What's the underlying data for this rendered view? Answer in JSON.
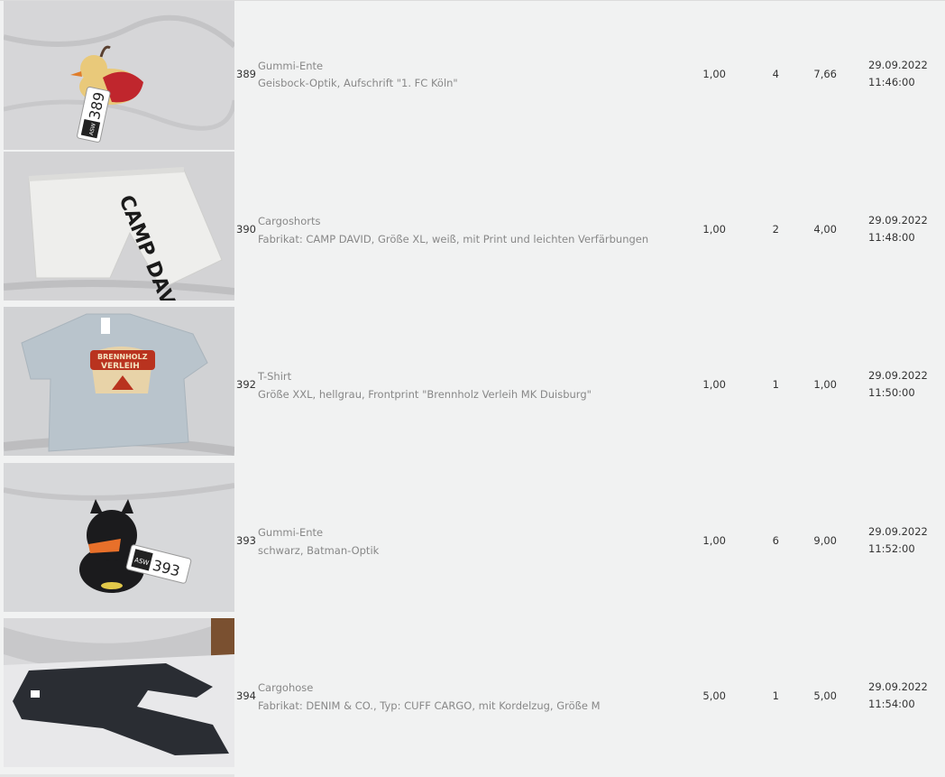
{
  "items": [
    {
      "lot": "389",
      "title": "Gummi-Ente",
      "desc": "Geisbock-Optik, Aufschrift \"1. FC Köln\"",
      "min": "1,00",
      "bids": "4",
      "price": "7,66",
      "date": "29.09.2022",
      "time": "11:46:00",
      "tag": "389"
    },
    {
      "lot": "390",
      "title": "Cargoshorts",
      "desc": "Fabrikat: CAMP DAVID, Größe XL, weiß, mit Print und leichten Verfärbungen",
      "min": "1,00",
      "bids": "2",
      "price": "4,00",
      "date": "29.09.2022",
      "time": "11:48:00",
      "print": "CAMP DAVID"
    },
    {
      "lot": "392",
      "title": "T-Shirt",
      "desc": "Größe XXL, hellgrau, Frontprint \"Brennholz Verleih MK Duisburg\"",
      "min": "1,00",
      "bids": "1",
      "price": "1,00",
      "date": "29.09.2022",
      "time": "11:50:00",
      "print1": "BRENNHOLZ",
      "print2": "VERLEIH"
    },
    {
      "lot": "393",
      "title": "Gummi-Ente",
      "desc": "schwarz, Batman-Optik",
      "min": "1,00",
      "bids": "6",
      "price": "9,00",
      "date": "29.09.2022",
      "time": "11:52:00",
      "tag": "393"
    },
    {
      "lot": "394",
      "title": "Cargohose",
      "desc": "Fabrikat: DENIM & CO., Typ: CUFF CARGO, mit Kordelzug, Größe M",
      "min": "5,00",
      "bids": "1",
      "price": "5,00",
      "date": "29.09.2022",
      "time": "11:54:00"
    }
  ],
  "tag_brand": "ASW",
  "colors": {
    "background": "#f1f2f2",
    "title": "#888888",
    "text": "#333333"
  }
}
